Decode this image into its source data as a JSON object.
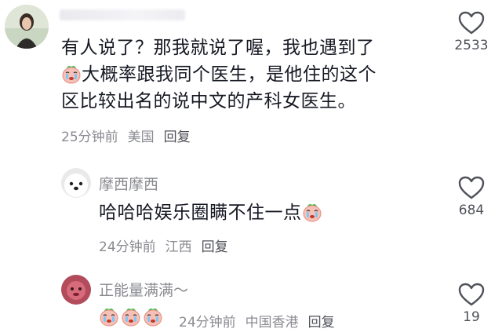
{
  "comments": [
    {
      "author": "",
      "text_line1": "有人说了？那我就说了喔，我也遇到了",
      "text_line2_after_emoji": "大概率跟我同个医生，是他住的这个",
      "text_line3": "区比较出名的说中文的产科女医生。",
      "time": "25分钟前",
      "location": "美国",
      "reply_label": "回复",
      "like_count": "2533"
    },
    {
      "author": "摩西摩西",
      "text": "哈哈哈娱乐圈瞒不住一点",
      "time": "24分钟前",
      "location": "江西",
      "reply_label": "回复",
      "like_count": "684"
    },
    {
      "author": "正能量满满～",
      "time": "24分钟前",
      "location": "中国香港",
      "reply_label": "回复",
      "like_count": "19"
    }
  ],
  "icons": {
    "like": "heart-outline-icon",
    "emoji": "crying-face-emoji-icon"
  },
  "colors": {
    "text": "#161823",
    "meta": "#8a8b91",
    "name": "#8a8b91"
  }
}
